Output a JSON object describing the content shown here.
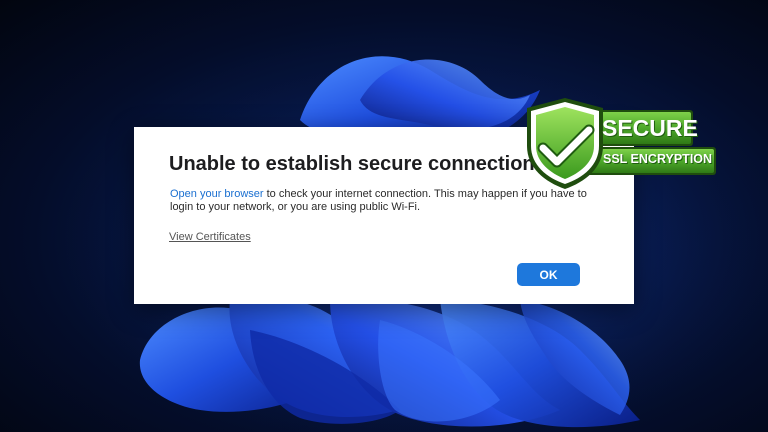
{
  "dialog": {
    "title": "Unable to establish secure connection to",
    "link_text": "Open your browser",
    "body_text": " to check your internet connection. This may happen if you have to login to your network, or you are using public Wi-Fi.",
    "view_certificates_label": "View Certificates",
    "ok_label": "OK"
  },
  "badge": {
    "title": "SECURE",
    "subtitle": "SSL ENCRYPTION",
    "icon": "checkmark-shield-icon"
  },
  "colors": {
    "accent": "#1e78dc",
    "link": "#1a6fd0",
    "badge_green": "#5cb82e"
  }
}
